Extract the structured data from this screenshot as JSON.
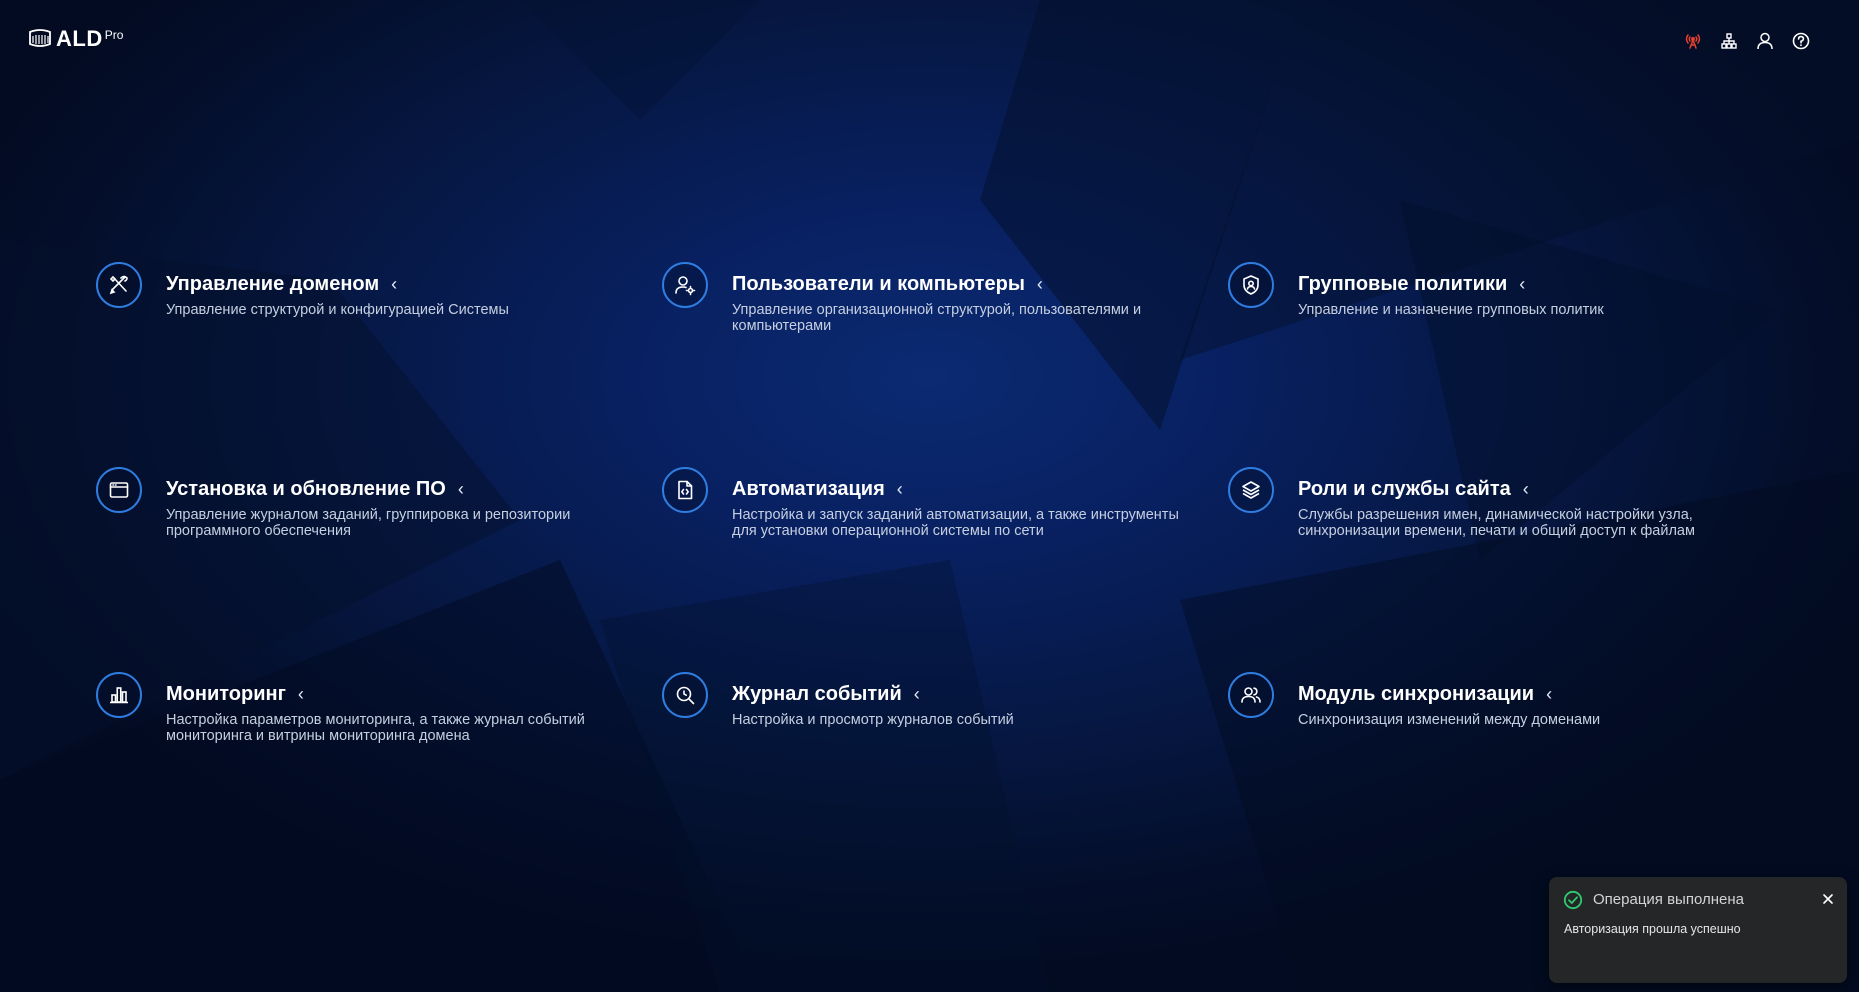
{
  "app": {
    "logo_text": "ALD",
    "logo_sup": "Pro"
  },
  "header": {
    "icons": [
      "network-alert-icon",
      "sitemap-icon",
      "user-icon",
      "help-icon"
    ],
    "alert_color": "#e8412f"
  },
  "colors": {
    "accent": "#2f7de1",
    "success": "#2ecc71",
    "toast_bg": "#242628"
  },
  "modules": [
    {
      "icon": "tools-icon",
      "title": "Управление доменом",
      "desc": "Управление структурой и конфигурацией Системы"
    },
    {
      "icon": "user-settings-icon",
      "title": "Пользователи и компьютеры",
      "desc": "Управление организационной структурой, пользователями и компьютерами"
    },
    {
      "icon": "shield-user-icon",
      "title": "Групповые политики",
      "desc": "Управление и назначение групповых политик"
    },
    {
      "icon": "app-window-icon",
      "title": "Установка и обновление ПО",
      "desc": "Управление журналом заданий, группировка и репозитории программного обеспечения"
    },
    {
      "icon": "code-file-icon",
      "title": "Автоматизация",
      "desc": "Настройка и запуск заданий автоматизации, а также инструменты для установки операционной системы по сети"
    },
    {
      "icon": "layers-icon",
      "title": "Роли и службы сайта",
      "desc": "Службы разрешения имен, динамической настройки узла, синхронизации времени, печати и общий доступ к файлам"
    },
    {
      "icon": "bar-chart-icon",
      "title": "Мониторинг",
      "desc": "Настройка параметров мониторинга, а также журнал событий мониторинга и витрины мониторинга домена"
    },
    {
      "icon": "search-log-icon",
      "title": "Журнал событий",
      "desc": "Настройка и просмотр журналов событий"
    },
    {
      "icon": "users-sync-icon",
      "title": "Модуль синхронизации",
      "desc": "Синхронизация изменений между доменами"
    }
  ],
  "toast": {
    "title": "Операция выполнена",
    "message": "Авторизация прошла успешно",
    "icon": "check-circle-icon"
  }
}
